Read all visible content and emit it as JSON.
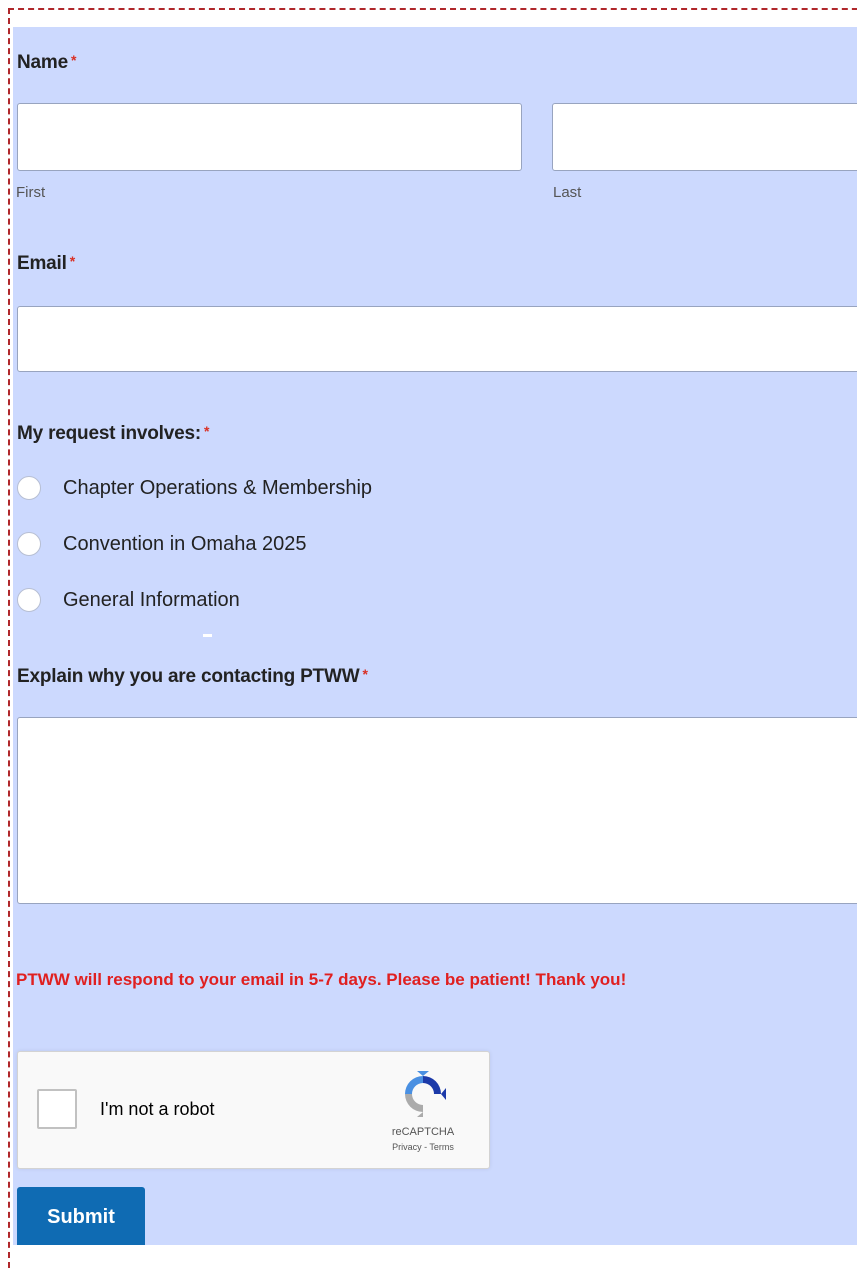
{
  "form": {
    "name": {
      "label": "Name",
      "required": "*",
      "first_sub": "First",
      "last_sub": "Last",
      "first_value": "",
      "last_value": ""
    },
    "email": {
      "label": "Email",
      "required": "*",
      "value": ""
    },
    "request": {
      "label": "My request involves:",
      "required": "*",
      "options": [
        "Chapter Operations & Membership",
        "Convention in Omaha 2025",
        "General Information"
      ]
    },
    "explain": {
      "label": "Explain why you are contacting PTWW",
      "required": "*",
      "value": ""
    },
    "notice": "PTWW will respond to your email in 5-7 days.  Please be patient!  Thank you!",
    "captcha": {
      "text": "I'm not a robot",
      "brand": "reCAPTCHA",
      "links": "Privacy - Terms"
    },
    "submit_label": "Submit"
  },
  "colors": {
    "panel": "#ccd9fe",
    "required": "#d93025",
    "notice": "#e02020",
    "submit": "#0f6bb3",
    "frame": "#b0282b"
  }
}
